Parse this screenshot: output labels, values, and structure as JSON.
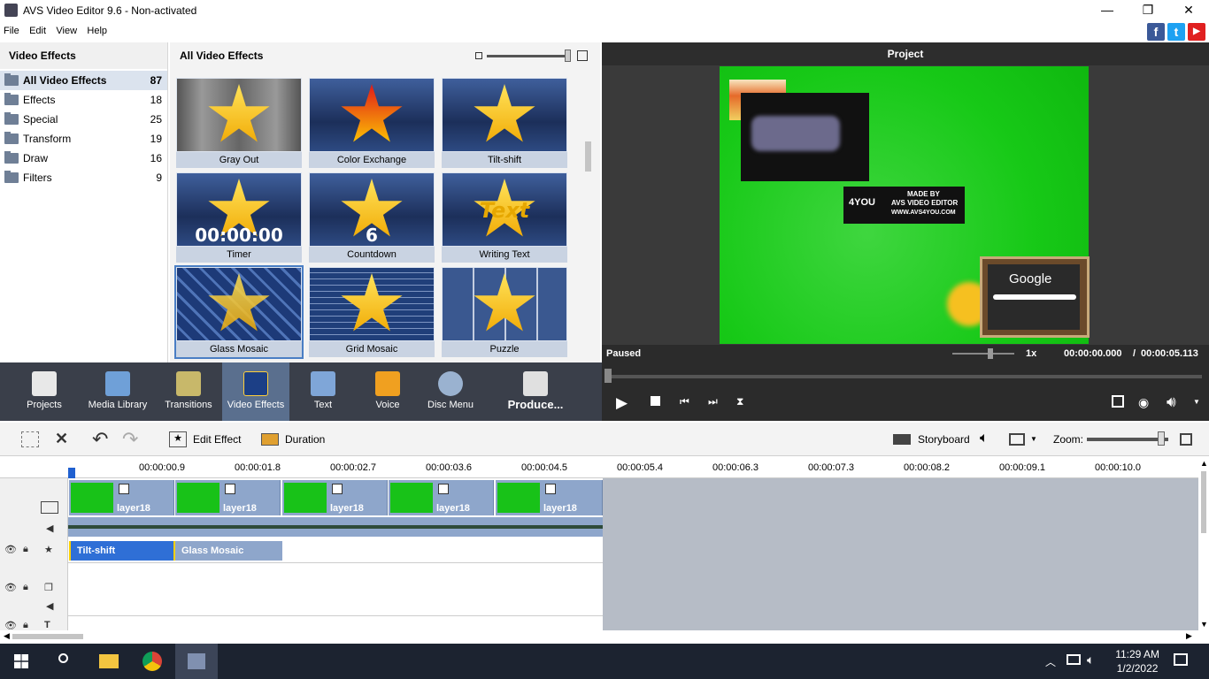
{
  "window": {
    "title": "AVS Video Editor 9.6 - Non-activated",
    "min_icon": "minimize-icon",
    "max_icon": "maximize-icon",
    "close_icon": "close-icon"
  },
  "menu": [
    "File",
    "Edit",
    "View",
    "Help"
  ],
  "social": {
    "facebook": "f",
    "twitter": "t",
    "youtube": "▶"
  },
  "left_panel": {
    "title": "Video Effects",
    "categories": [
      {
        "label": "All Video Effects",
        "count": "87"
      },
      {
        "label": "Effects",
        "count": "18"
      },
      {
        "label": "Special",
        "count": "25"
      },
      {
        "label": "Transform",
        "count": "19"
      },
      {
        "label": "Draw",
        "count": "16"
      },
      {
        "label": "Filters",
        "count": "9"
      }
    ]
  },
  "grid_panel": {
    "title": "All Video Effects",
    "effects": [
      {
        "label": "Gray Out",
        "overlay": ""
      },
      {
        "label": "Color Exchange",
        "overlay": ""
      },
      {
        "label": "Tilt-shift",
        "overlay": ""
      },
      {
        "label": "Timer",
        "overlay": "00:00:00"
      },
      {
        "label": "Countdown",
        "overlay": "6"
      },
      {
        "label": "Writing Text",
        "overlay": "Text"
      },
      {
        "label": "Glass Mosaic",
        "overlay": ""
      },
      {
        "label": "Grid Mosaic",
        "overlay": ""
      },
      {
        "label": "Puzzle",
        "overlay": ""
      }
    ]
  },
  "preview": {
    "title": "Project",
    "status": "Paused",
    "speed": "1x",
    "time_current": "00:00:00.000",
    "time_sep": "/",
    "time_total": "00:00:05.113",
    "watermark_line1": "MADE BY",
    "watermark_line2": "AVS VIDEO EDITOR",
    "watermark_line3": "WWW.AVS4YOU.COM",
    "watermark_logo": "4YOU",
    "google_label": "Google"
  },
  "tabs": [
    {
      "label": "Projects",
      "icon": "projects-icon",
      "color": "#e8e8e8"
    },
    {
      "label": "Media Library",
      "icon": "media-library-icon",
      "color": "#6fa0d8"
    },
    {
      "label": "Transitions",
      "icon": "transitions-icon",
      "color": "#c8b86a"
    },
    {
      "label": "Video Effects",
      "icon": "video-effects-icon",
      "color": "#3a5fa8"
    },
    {
      "label": "Text",
      "icon": "text-icon",
      "color": "#7fa6d8"
    },
    {
      "label": "Voice",
      "icon": "voice-icon",
      "color": "#f0a020"
    },
    {
      "label": "Disc Menu",
      "icon": "disc-menu-icon",
      "color": "#9ab2d0"
    },
    {
      "label": "Produce...",
      "icon": "produce-icon",
      "color": "#e0e0e0"
    }
  ],
  "edit_tools": {
    "edit_effect": "Edit Effect",
    "duration": "Duration",
    "storyboard": "Storyboard",
    "zoom": "Zoom:"
  },
  "ruler": [
    "00:00:00.9",
    "00:00:01.8",
    "00:00:02.7",
    "00:00:03.6",
    "00:00:04.5",
    "00:00:05.4",
    "00:00:06.3",
    "00:00:07.3",
    "00:00:08.2",
    "00:00:09.1",
    "00:00:10.0"
  ],
  "clips": [
    "layer18",
    "layer18",
    "layer18",
    "layer18",
    "layer18"
  ],
  "effect_clips": [
    {
      "label": "Tilt-shift",
      "color": "#2f6fd6"
    },
    {
      "label": "Glass Mosaic",
      "color": "#8ea6cb"
    }
  ],
  "taskbar": {
    "time": "11:29 AM",
    "date": "1/2/2022"
  }
}
